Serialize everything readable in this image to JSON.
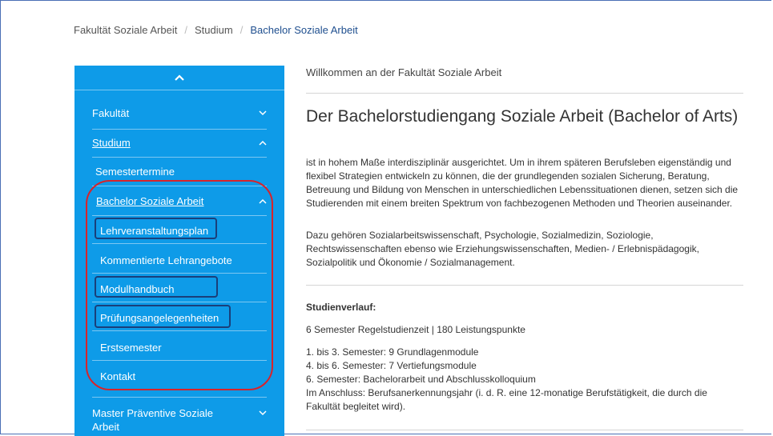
{
  "breadcrumb": {
    "items": [
      "Fakultät Soziale Arbeit",
      "Studium",
      "Bachelor Soziale Arbeit"
    ]
  },
  "sidebar": {
    "collapse_icon": "chevron-up-icon",
    "items": [
      {
        "label": "Fakultät",
        "icon": "chevron-down-icon"
      },
      {
        "label": "Studium",
        "icon": "chevron-up-icon"
      },
      {
        "label": "Semestertermine"
      },
      {
        "label": "Bachelor Soziale Arbeit",
        "icon": "chevron-up-icon"
      },
      {
        "label": "Lehrveranstaltungsplan"
      },
      {
        "label": "Kommentierte Lehrangebote"
      },
      {
        "label": "Modulhandbuch"
      },
      {
        "label": "Prüfungsangelegenheiten"
      },
      {
        "label": "Erstsemester"
      },
      {
        "label": "Kontakt"
      },
      {
        "label": "Master Präventive Soziale Arbeit",
        "icon": "chevron-down-icon"
      }
    ]
  },
  "main": {
    "welcome": "Willkommen an der Fakultät Soziale Arbeit",
    "heading": "Der Bachelorstudiengang Soziale Arbeit (Bachelor of Arts)",
    "intro": "ist in hohem Maße interdisziplinär ausgerichtet. Um in ihrem späteren Berufsleben eigenständig und flexibel Strategien entwickeln zu können, die der grundlegenden sozialen Sicherung, Beratung, Betreuung und Bildung von Menschen in unterschiedlichen Lebenssituationen dienen, setzen sich die Studierenden mit einem breiten Spektrum von fachbezogenen Methoden und Theorien auseinander.",
    "intro2": "Dazu gehören Sozialarbeitswissenschaft, Psychologie, Sozialmedizin, Soziologie, Rechtswissenschaften ebenso wie Erziehungswissenschaften, Medien- / Erlebnispädagogik, Sozialpolitik und Ökonomie / Sozialmanagement.",
    "studienverlauf_title": "Studienverlauf:",
    "regelstudienzeit": "6 Semester Regelstudienzeit | 180 Leistungspunkte",
    "semesters": [
      "1. bis 3. Semester: 9 Grundlagenmodule",
      "4. bis 6. Semester: 7 Vertiefungsmodule",
      "6. Semester: Bachelorarbeit und Abschlusskolloquium"
    ],
    "anschluss": "Im Anschluss: Berufsanerkennungsjahr (i. d. R. eine 12-monatige Berufstätigkeit, die durch die Fakultät begleitet wird)."
  },
  "colors": {
    "sidebar_bg": "#0e9be8",
    "highlight_red": "#d8232a",
    "highlight_box": "#1a3f7a",
    "link": "#1f4f8f"
  }
}
